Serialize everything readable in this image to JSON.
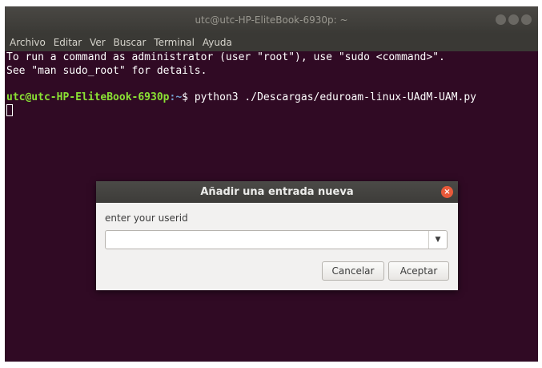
{
  "window": {
    "title": "utc@utc-HP-EliteBook-6930p: ~"
  },
  "menubar": {
    "items": [
      "Archivo",
      "Editar",
      "Ver",
      "Buscar",
      "Terminal",
      "Ayuda"
    ]
  },
  "terminal": {
    "line1": "To run a command as administrator (user \"root\"), use \"sudo <command>\".",
    "line2": "See \"man sudo_root\" for details.",
    "prompt_user": "utc@utc-HP-EliteBook-6930p",
    "prompt_path": ":~",
    "prompt_sign": "$ ",
    "command": "python3 ./Descargas/eduroam-linux-UAdM-UAM.py"
  },
  "dialog": {
    "title": "Añadir una entrada nueva",
    "close_glyph": "×",
    "label": "enter your userid",
    "input_value": "",
    "dropdown_glyph": "▼",
    "cancel_label": "Cancelar",
    "accept_label": "Aceptar"
  }
}
